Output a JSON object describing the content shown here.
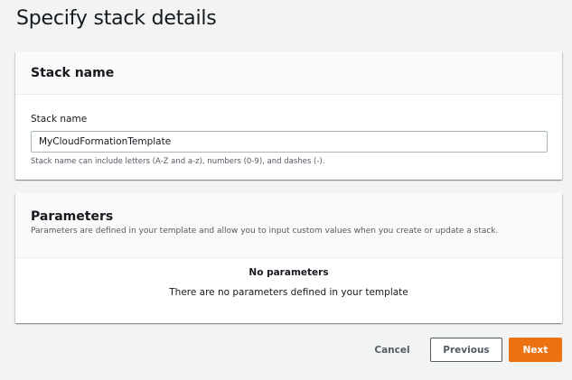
{
  "page": {
    "title": "Specify stack details"
  },
  "stack_panel": {
    "title": "Stack name",
    "field_label": "Stack name",
    "field_value": "MyCloudFormationTemplate",
    "field_hint": "Stack name can include letters (A-Z and a-z), numbers (0-9), and dashes (-)."
  },
  "params_panel": {
    "title": "Parameters",
    "description": "Parameters are defined in your template and allow you to input custom values when you create or update a stack.",
    "empty_title": "No parameters",
    "empty_description": "There are no parameters defined in your template"
  },
  "actions": {
    "cancel_label": "Cancel",
    "previous_label": "Previous",
    "next_label": "Next"
  },
  "colors": {
    "primary": "#ec7211",
    "background": "#f2f3f3",
    "text": "#16191f",
    "muted": "#545b64"
  }
}
